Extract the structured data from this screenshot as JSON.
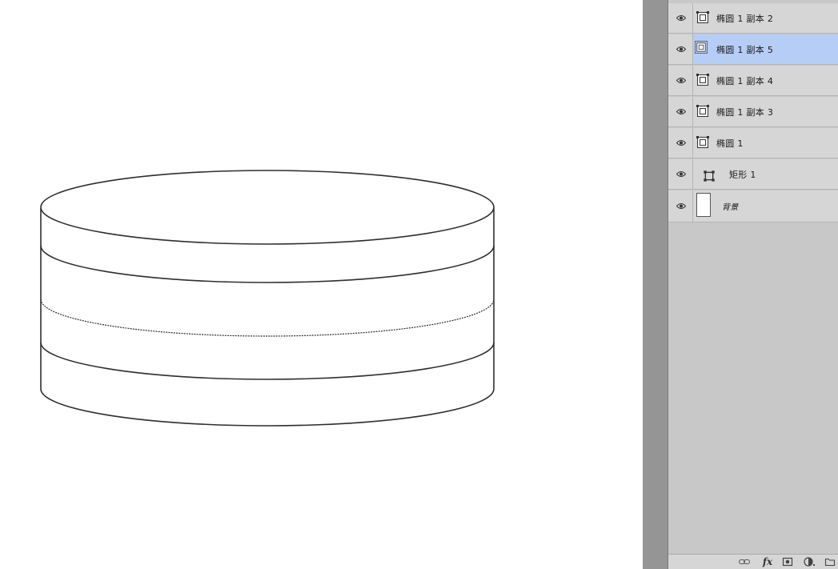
{
  "layers": [
    {
      "name": "椭圆 1 副本 2",
      "kind": "shape",
      "selected": false
    },
    {
      "name": "椭圆 1 副本 5",
      "kind": "shape",
      "selected": true
    },
    {
      "name": "椭圆 1 副本 4",
      "kind": "shape",
      "selected": false
    },
    {
      "name": "椭圆 1 副本 3",
      "kind": "shape",
      "selected": false
    },
    {
      "name": "椭圆 1",
      "kind": "shape",
      "selected": false
    },
    {
      "name": "矩形 1",
      "kind": "rect",
      "selected": false
    },
    {
      "name": "背景",
      "kind": "background",
      "selected": false
    }
  ],
  "colors": {
    "selected_row": "#b6cdf5",
    "panel_bg": "#c8c8c8",
    "row_bg": "#d6d6d6",
    "gutter": "#959595",
    "stroke": "#2e2e2e"
  },
  "icons": {
    "visibility": "eye-icon",
    "shape_layer": "vector-mask-icon",
    "rect_layer": "path-rect-icon",
    "link": "link-icon",
    "fx": "fx-icon",
    "mask": "add-mask-icon",
    "adjustment": "adjustment-layer-icon",
    "group": "folder-icon"
  },
  "bottom_bar": {
    "fx_label": "fx"
  }
}
